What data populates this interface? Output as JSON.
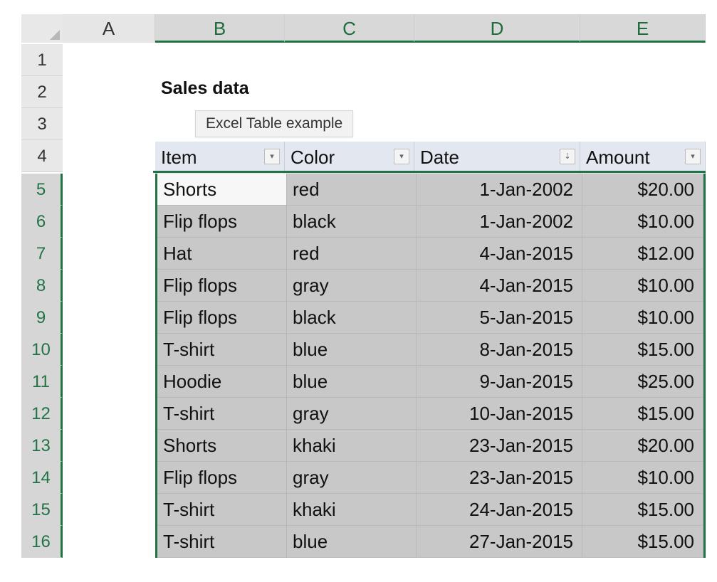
{
  "sheet": {
    "columns": [
      "A",
      "B",
      "C",
      "D",
      "E"
    ],
    "rows": [
      "1",
      "2",
      "3",
      "4",
      "5",
      "6",
      "7",
      "8",
      "9",
      "10",
      "11",
      "12",
      "13",
      "14",
      "15",
      "16"
    ]
  },
  "content": {
    "title": "Sales data",
    "tooltip": "Excel Table example"
  },
  "table": {
    "headers": [
      "Item",
      "Color",
      "Date",
      "Amount"
    ],
    "filter_icons": [
      "filter-dropdown-icon",
      "filter-dropdown-icon",
      "sort-filter-icon",
      "filter-dropdown-icon"
    ],
    "rows": [
      [
        "Shorts",
        "red",
        "1-Jan-2002",
        "$20.00"
      ],
      [
        "Flip flops",
        "black",
        "1-Jan-2002",
        "$10.00"
      ],
      [
        "Hat",
        "red",
        "4-Jan-2015",
        "$12.00"
      ],
      [
        "Flip flops",
        "gray",
        "4-Jan-2015",
        "$10.00"
      ],
      [
        "Flip flops",
        "black",
        "5-Jan-2015",
        "$10.00"
      ],
      [
        "T-shirt",
        "blue",
        "8-Jan-2015",
        "$15.00"
      ],
      [
        "Hoodie",
        "blue",
        "9-Jan-2015",
        "$25.00"
      ],
      [
        "T-shirt",
        "gray",
        "10-Jan-2015",
        "$15.00"
      ],
      [
        "Shorts",
        "khaki",
        "23-Jan-2015",
        "$20.00"
      ],
      [
        "Flip flops",
        "gray",
        "23-Jan-2015",
        "$10.00"
      ],
      [
        "T-shirt",
        "khaki",
        "24-Jan-2015",
        "$15.00"
      ],
      [
        "T-shirt",
        "blue",
        "27-Jan-2015",
        "$15.00"
      ]
    ]
  },
  "colors": {
    "selection_accent": "#217346",
    "selected_fill": "#c8c8c8",
    "header_fill": "#e3e8f0"
  }
}
